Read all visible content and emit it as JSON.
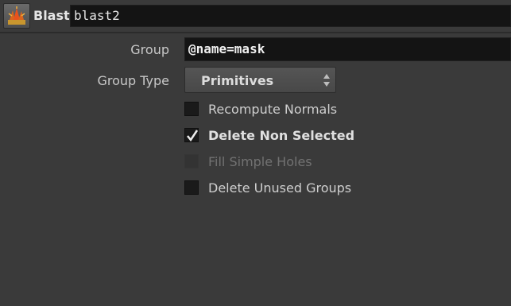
{
  "header": {
    "node_icon": "blast-node-icon",
    "node_type": "Blast",
    "node_name": "blast2"
  },
  "params": {
    "group": {
      "label": "Group",
      "value": "@name=mask"
    },
    "group_type": {
      "label": "Group Type",
      "selected": "Primitives"
    },
    "toggles": [
      {
        "label": "Recompute Normals",
        "checked": false,
        "enabled": true
      },
      {
        "label": "Delete Non Selected",
        "checked": true,
        "enabled": true
      },
      {
        "label": "Fill Simple Holes",
        "checked": false,
        "enabled": false
      },
      {
        "label": "Delete Unused Groups",
        "checked": false,
        "enabled": true
      }
    ]
  },
  "colors": {
    "background": "#3a3a3a",
    "field": "#141414",
    "icon_accent": "#e8531d"
  }
}
